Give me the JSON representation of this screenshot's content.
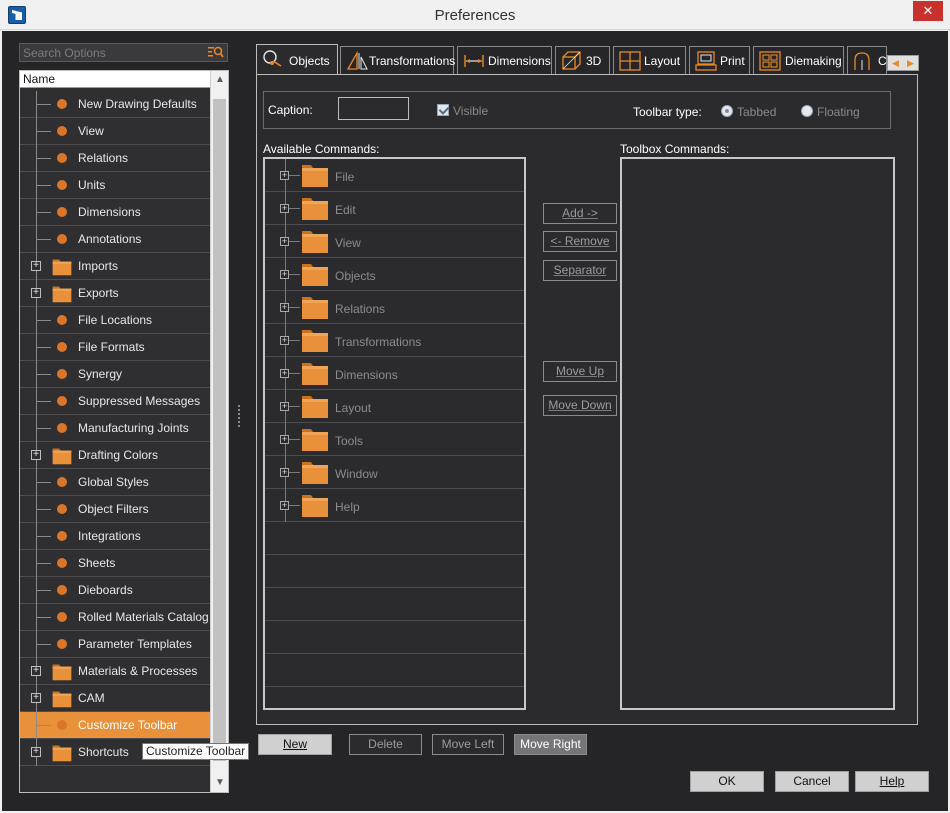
{
  "window": {
    "title": "Preferences",
    "close_symbol": "✕"
  },
  "search": {
    "placeholder": "Search Options",
    "icon": "search-filter-icon"
  },
  "tree": {
    "header": "Name",
    "items": [
      {
        "label": "New Drawing Defaults",
        "kind": "leaf"
      },
      {
        "label": "View",
        "kind": "leaf"
      },
      {
        "label": "Relations",
        "kind": "leaf"
      },
      {
        "label": "Units",
        "kind": "leaf"
      },
      {
        "label": "Dimensions",
        "kind": "leaf"
      },
      {
        "label": "Annotations",
        "kind": "leaf"
      },
      {
        "label": "Imports",
        "kind": "folder"
      },
      {
        "label": "Exports",
        "kind": "folder"
      },
      {
        "label": "File Locations",
        "kind": "leaf"
      },
      {
        "label": "File Formats",
        "kind": "leaf"
      },
      {
        "label": "Synergy",
        "kind": "leaf"
      },
      {
        "label": "Suppressed Messages",
        "kind": "leaf"
      },
      {
        "label": "Manufacturing Joints",
        "kind": "leaf"
      },
      {
        "label": "Drafting Colors",
        "kind": "folder"
      },
      {
        "label": "Global Styles",
        "kind": "leaf"
      },
      {
        "label": "Object Filters",
        "kind": "leaf"
      },
      {
        "label": "Integrations",
        "kind": "leaf"
      },
      {
        "label": "Sheets",
        "kind": "leaf"
      },
      {
        "label": "Dieboards",
        "kind": "leaf"
      },
      {
        "label": "Rolled Materials Catalog",
        "kind": "leaf"
      },
      {
        "label": "Parameter Templates",
        "kind": "leaf"
      },
      {
        "label": "Materials & Processes",
        "kind": "folder"
      },
      {
        "label": "CAM",
        "kind": "folder"
      },
      {
        "label": "Customize Toolbar",
        "kind": "leaf",
        "selected": true
      },
      {
        "label": "Shortcuts",
        "kind": "folder"
      }
    ],
    "tooltip": "Customize Toolbar",
    "scroll_up": "▲",
    "scroll_down": "▼"
  },
  "tabs": [
    {
      "label": "Objects",
      "icon": "objects-icon",
      "active": true
    },
    {
      "label": "Transformations",
      "icon": "transformations-icon"
    },
    {
      "label": "Dimensions",
      "icon": "dimensions-icon"
    },
    {
      "label": "3D",
      "icon": "3d-icon"
    },
    {
      "label": "Layout",
      "icon": "layout-icon"
    },
    {
      "label": "Print",
      "icon": "print-icon"
    },
    {
      "label": "Diemaking",
      "icon": "diemaking-icon"
    },
    {
      "label": "C",
      "icon": "cam-icon"
    }
  ],
  "tab_scroll": {
    "left": "◀",
    "right": "▶"
  },
  "caption": {
    "label": "Caption:",
    "value": "",
    "visible_label": "Visible",
    "visible_checked": true,
    "toolbar_type_label": "Toolbar type:",
    "tabbed_label": "Tabbed",
    "floating_label": "Floating",
    "selected_type": "Tabbed"
  },
  "available": {
    "title": "Available Commands:",
    "items": [
      "File",
      "Edit",
      "View",
      "Objects",
      "Relations",
      "Transformations",
      "Dimensions",
      "Layout",
      "Tools",
      "Window",
      "Help"
    ]
  },
  "toolbox": {
    "title": "Toolbox Commands:",
    "items": []
  },
  "mid_buttons": {
    "add": "Add ->",
    "remove": "<- Remove",
    "separator": "Separator",
    "move_up": "Move Up",
    "move_down": "Move Down"
  },
  "bottom_buttons": {
    "new": "New",
    "delete": "Delete",
    "move_left": "Move Left",
    "move_right": "Move Right"
  },
  "dialog_buttons": {
    "ok": "OK",
    "cancel": "Cancel",
    "help": "Help"
  },
  "colors": {
    "accent": "#e8903a",
    "background": "#2b2b2d",
    "folder": "#e8913a"
  }
}
